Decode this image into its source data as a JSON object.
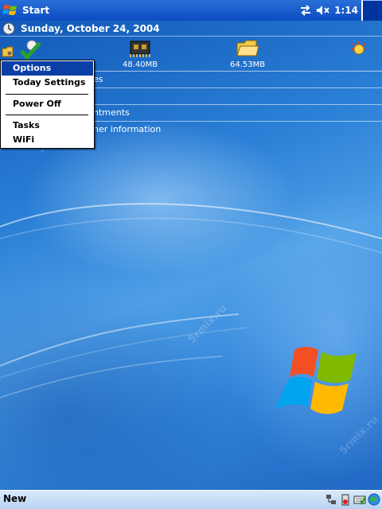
{
  "titlebar": {
    "title": "Start",
    "time": "1:14",
    "icons": [
      "windows-flag-icon",
      "connectivity-icon",
      "speaker-muted-icon",
      "ok-box"
    ]
  },
  "today": {
    "date": "Sunday, October 24, 2004",
    "status": {
      "memory": "48.40MB",
      "storage": "64.53MB"
    },
    "lines": {
      "line1": "es",
      "line2": "",
      "line3": "ntments",
      "line4": "ner information"
    }
  },
  "context_menu": {
    "items": [
      "Options",
      "Today Settings",
      "Power Off",
      "Tasks",
      "WiFi"
    ],
    "selected": "Options"
  },
  "bottombar": {
    "left_label": "New",
    "tray_icons": [
      "network-icon",
      "battery-icon",
      "keyboard-icon",
      "globe-icon"
    ]
  },
  "watermark": "5rmix.ru",
  "colors": {
    "titlebar": "#0b4cc0",
    "menu_selected": "#0b3fa8",
    "bottombar": "#c7ddf6"
  }
}
